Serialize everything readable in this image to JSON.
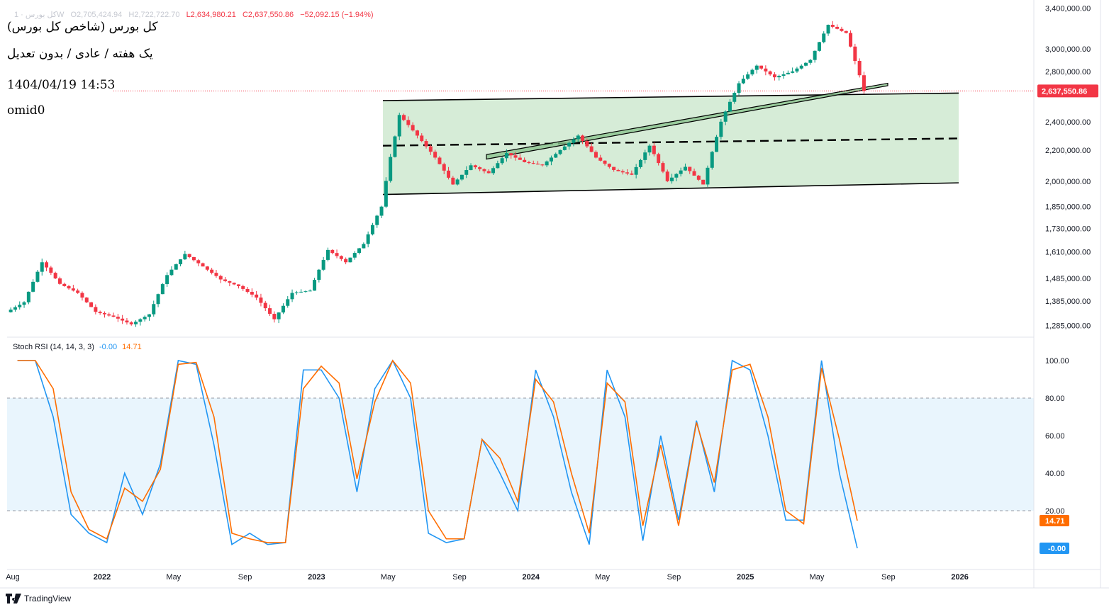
{
  "header": {
    "symbol_faded": "کل بورس · 1W",
    "open": "O2,705,424.94",
    "high": "H2,722,722.70",
    "low": "L2,634,980.21",
    "close": "C2,637,550.86",
    "change": "−52,092.15 (−1.94%)"
  },
  "notes": {
    "title": "کل بورس (شاخص کل بورس)",
    "subtitle": "یک هفته / عادی / بدون تعدیل",
    "datetime": "1404/04/19 14:53",
    "author": "omid0"
  },
  "indicator": {
    "label": "Stoch RSI (14, 14, 3, 3)",
    "k_value": "-0.00",
    "d_value": "14.71"
  },
  "brand": "TradingView",
  "colors": {
    "up": "#089981",
    "down": "#f23645",
    "channel_fill": "#c8e6c9",
    "k_line": "#2196f3",
    "d_line": "#ff6d00"
  },
  "chart_data": [
    {
      "type": "candlestick",
      "title": "کل بورس (شاخص کل بورس)",
      "scale": "log",
      "price_ticks": [
        "3,400,000.00",
        "3,000,000.00",
        "2,800,000.00",
        "2,400,000.00",
        "2,200,000.00",
        "2,000,000.00",
        "1,850,000.00",
        "1,730,000.00",
        "1,610,000.00",
        "1,485,000.00",
        "1,385,000.00",
        "1,285,000.00"
      ],
      "last_price_label": "2,637,550.86",
      "x_labels": [
        "Aug",
        "2022",
        "May",
        "Sep",
        "2023",
        "May",
        "Sep",
        "2024",
        "May",
        "Sep",
        "2025",
        "May",
        "Sep",
        "2026"
      ],
      "series": [
        {
          "name": "کل بورس",
          "x": [
            "2021-08",
            "2021-09",
            "2021-10",
            "2021-11",
            "2021-12",
            "2022-01",
            "2022-02",
            "2022-03",
            "2022-04",
            "2022-05",
            "2022-06",
            "2022-07",
            "2022-08",
            "2022-09",
            "2022-10",
            "2022-11",
            "2022-12",
            "2023-01",
            "2023-02",
            "2023-03",
            "2023-04",
            "2023-05",
            "2023-06",
            "2023-07",
            "2023-08",
            "2023-09",
            "2023-10",
            "2023-11",
            "2023-12",
            "2024-01",
            "2024-02",
            "2024-03",
            "2024-04",
            "2024-05",
            "2024-06",
            "2024-07",
            "2024-08",
            "2024-09",
            "2024-10",
            "2024-11",
            "2024-12",
            "2025-01",
            "2025-02",
            "2025-03",
            "2025-04",
            "2025-05",
            "2025-06",
            "2025-07"
          ],
          "close": [
            1380000,
            1560000,
            1460000,
            1420000,
            1340000,
            1320000,
            1290000,
            1330000,
            1500000,
            1600000,
            1540000,
            1480000,
            1450000,
            1400000,
            1310000,
            1420000,
            1430000,
            1620000,
            1560000,
            1650000,
            1850000,
            2450000,
            2300000,
            2150000,
            1980000,
            2100000,
            2050000,
            2180000,
            2120000,
            2100000,
            2200000,
            2300000,
            2150000,
            2070000,
            2040000,
            2230000,
            2000000,
            2090000,
            1980000,
            2400000,
            2700000,
            2850000,
            2750000,
            2800000,
            2900000,
            3230000,
            3150000,
            2637550.86
          ]
        }
      ],
      "channel": {
        "upper": [
          2560000,
          2620000
        ],
        "middle": [
          2230000,
          2280000
        ],
        "lower": [
          1920000,
          1990000
        ]
      }
    },
    {
      "type": "line",
      "title": "Stoch RSI (14, 14, 3, 3)",
      "ylim": [
        0,
        100
      ],
      "y_ticks": [
        "100.00",
        "80.00",
        "60.00",
        "40.00",
        "20.00"
      ],
      "band": [
        20,
        80
      ],
      "x": [
        "2021-08",
        "2021-09",
        "2021-10",
        "2021-11",
        "2021-12",
        "2022-01",
        "2022-02",
        "2022-03",
        "2022-04",
        "2022-05",
        "2022-06",
        "2022-07",
        "2022-08",
        "2022-09",
        "2022-10",
        "2022-11",
        "2022-12",
        "2023-01",
        "2023-02",
        "2023-03",
        "2023-04",
        "2023-05",
        "2023-06",
        "2023-07",
        "2023-08",
        "2023-09",
        "2023-10",
        "2023-11",
        "2023-12",
        "2024-01",
        "2024-02",
        "2024-03",
        "2024-04",
        "2024-05",
        "2024-06",
        "2024-07",
        "2024-08",
        "2024-09",
        "2024-10",
        "2024-11",
        "2024-12",
        "2025-01",
        "2025-02",
        "2025-03",
        "2025-04",
        "2025-05",
        "2025-06",
        "2025-07"
      ],
      "series": [
        {
          "name": "K",
          "values": [
            100,
            100,
            70,
            18,
            8,
            3,
            40,
            18,
            45,
            100,
            98,
            55,
            2,
            8,
            2,
            3,
            95,
            95,
            80,
            30,
            85,
            100,
            80,
            8,
            3,
            5,
            58,
            40,
            20,
            95,
            70,
            30,
            2,
            95,
            70,
            4,
            60,
            15,
            68,
            30,
            100,
            95,
            60,
            15,
            15,
            100,
            40,
            0
          ]
        },
        {
          "name": "D",
          "values": [
            100,
            100,
            85,
            30,
            10,
            5,
            32,
            25,
            42,
            98,
            99,
            70,
            8,
            5,
            3,
            3,
            85,
            97,
            88,
            37,
            78,
            100,
            88,
            20,
            5,
            5,
            58,
            48,
            25,
            90,
            78,
            40,
            8,
            88,
            78,
            12,
            55,
            12,
            67,
            35,
            95,
            98,
            70,
            20,
            13,
            96,
            58,
            14.71
          ]
        }
      ]
    }
  ]
}
